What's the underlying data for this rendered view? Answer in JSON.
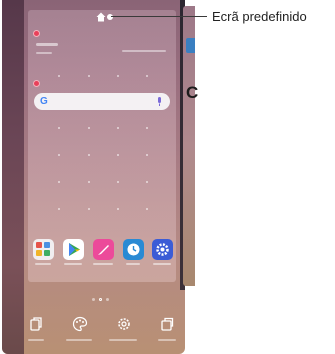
{
  "callout": {
    "label": "Ecrã predefinido"
  },
  "icons": {
    "home": "home-icon",
    "google": "google-logo",
    "mic": "microphone-icon",
    "remove": "remove-badge-icon",
    "gallery": "gallery-folder-icon",
    "play_store": "play-store-icon",
    "note": "note-pen-icon",
    "clock": "clock-icon",
    "settings": "settings-icon",
    "widgets": "widgets-icon",
    "wallpaper": "wallpaper-palette-icon",
    "home_settings": "home-settings-gear-icon",
    "themes": "themes-icon"
  },
  "search": {
    "logo_text": "G"
  },
  "peek": {
    "letter": "C"
  },
  "colors": {
    "accent_blue": "#3a7fc1",
    "remove_red": "#e8405a",
    "play_green": "#34a853",
    "note_pink": "#ec4a9a",
    "clock_blue": "#2a8ad4",
    "settings_blue": "#3b5cd6"
  }
}
